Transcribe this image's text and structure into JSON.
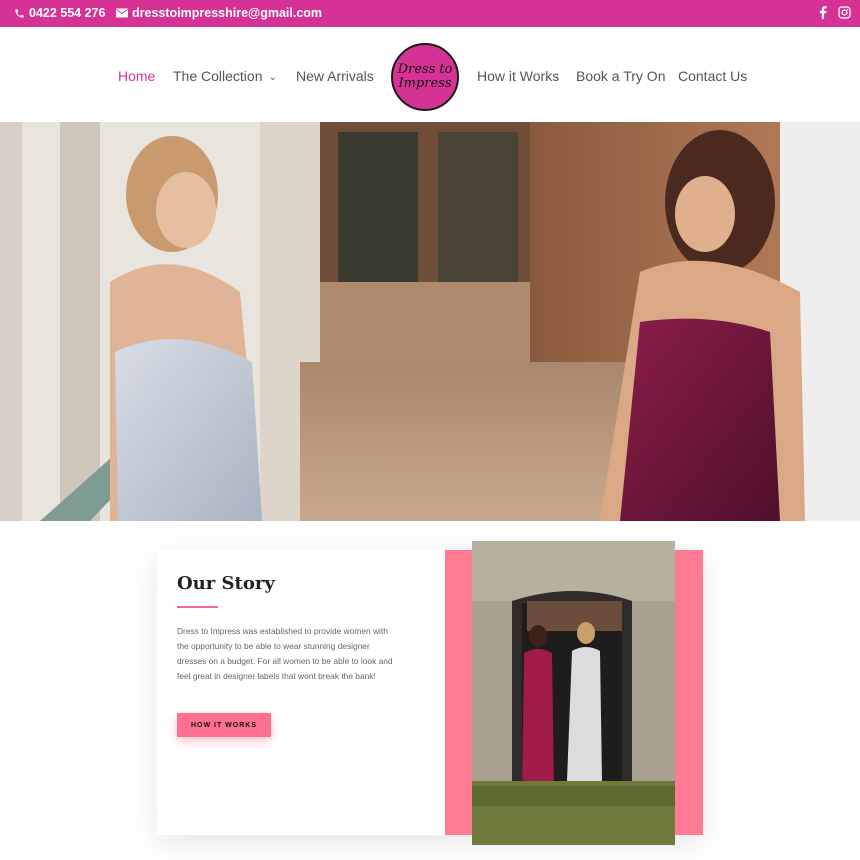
{
  "topbar": {
    "phone": "0422 554 276",
    "email": "dresstoimpresshire@gmail.com",
    "phone_icon": "phone-icon",
    "email_icon": "envelope-icon",
    "social": [
      "facebook-icon",
      "instagram-icon"
    ]
  },
  "nav": {
    "items": [
      {
        "label": "Home",
        "active": true
      },
      {
        "label": "The Collection",
        "has_dropdown": true
      },
      {
        "label": "New Arrivals"
      },
      {
        "label": "How it Works"
      },
      {
        "label": "Book a Try On"
      },
      {
        "label": "Contact Us"
      }
    ]
  },
  "logo": {
    "line1": "Dress to",
    "line2": "Impress"
  },
  "story": {
    "title": "Our Story",
    "text": "Dress to Impress was established to provide women with the opportunity to be able to wear stunning designer dresses on a budget. For all women to be able to look and feel great in designer labels that wont break the bank!",
    "button": "HOW IT WORKS"
  },
  "colors": {
    "brand_pink": "#d63296",
    "accent_pink": "#ff7a93"
  }
}
